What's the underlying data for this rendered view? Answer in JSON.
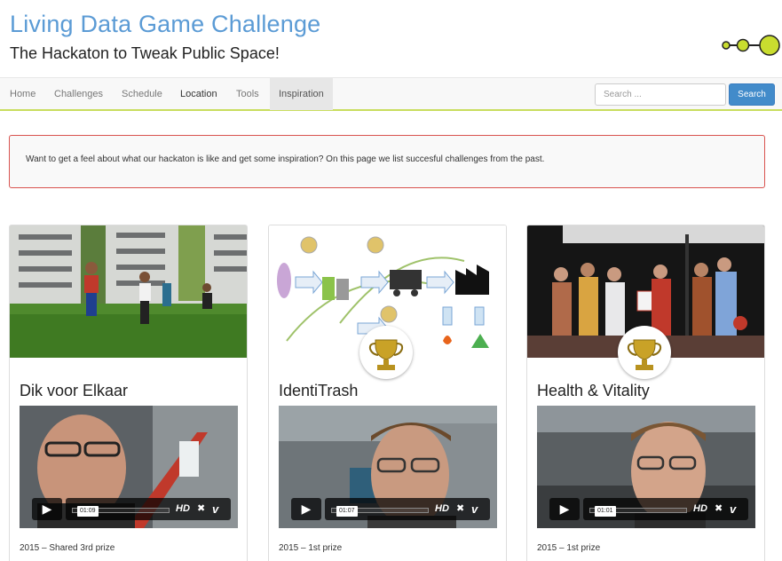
{
  "site": {
    "title": "Living Data Game Challenge",
    "subtitle": "The Hackaton to Tweak Public Space!",
    "logo_icon": "dots-logo",
    "accent": "#c9dd2f"
  },
  "nav": {
    "items": [
      {
        "label": "Home"
      },
      {
        "label": "Challenges"
      },
      {
        "label": "Schedule"
      },
      {
        "label": "Location"
      },
      {
        "label": "Tools"
      },
      {
        "label": "Inspiration",
        "active": true
      }
    ],
    "search_placeholder": "Search ...",
    "search_button": "Search"
  },
  "alert": {
    "text": "Want to get a feel about what our hackaton is like and get some inspiration? On this page we list succesful challenges from the past."
  },
  "cards": [
    {
      "title": "Dik voor Elkaar",
      "video_time": "01:09",
      "hd": "HD",
      "caption": "2015 – Shared 3rd prize",
      "trophy": false
    },
    {
      "title": "IdentiTrash",
      "video_time": "01:07",
      "hd": "HD",
      "caption": "2015 – 1st prize",
      "trophy": true
    },
    {
      "title": "Health & Vitality",
      "video_time": "01:01",
      "hd": "HD",
      "caption": "2015 – 1st prize",
      "trophy": true
    }
  ],
  "icons": {
    "play": "play-icon",
    "fullscreen": "fullscreen-icon",
    "vimeo": "vimeo-icon",
    "trophy": "trophy-icon"
  }
}
